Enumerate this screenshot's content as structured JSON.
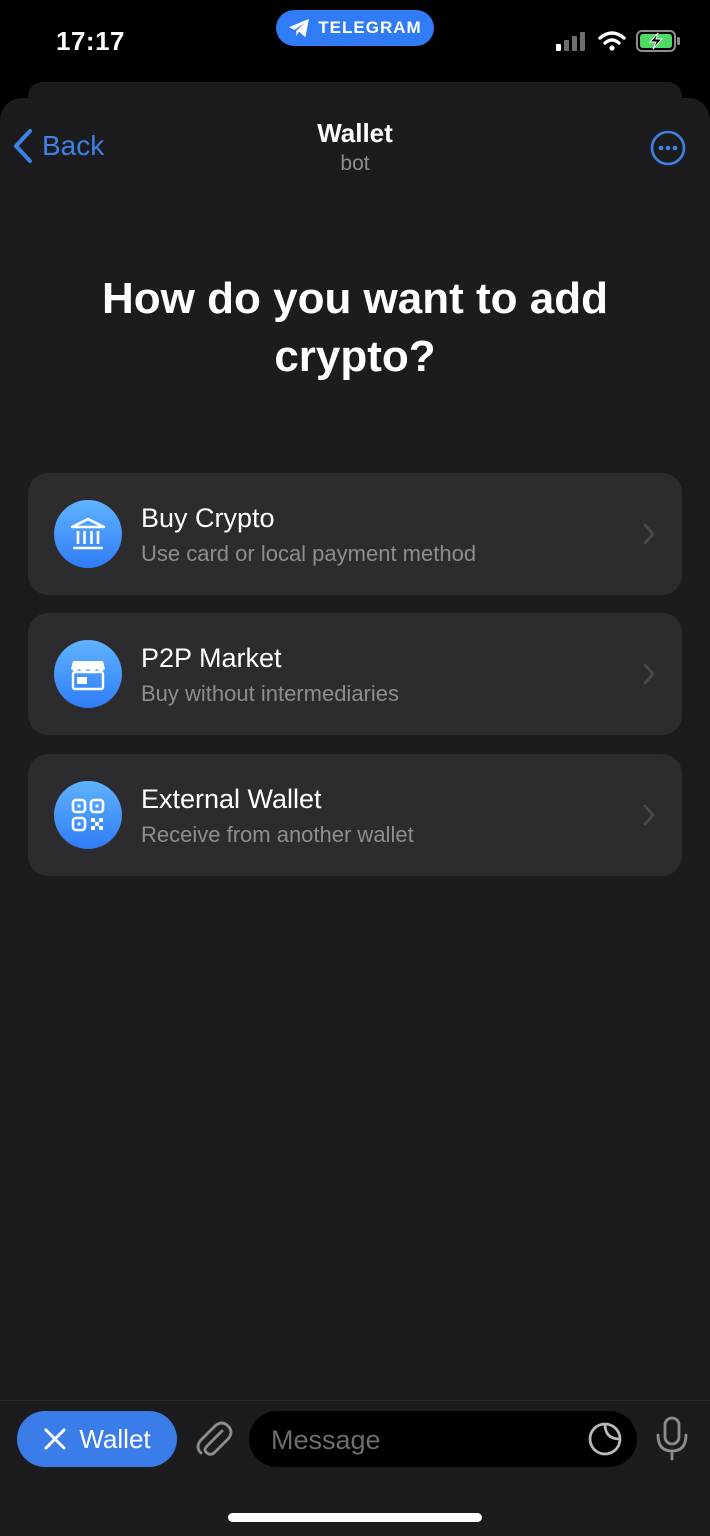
{
  "status_bar": {
    "time": "17:17",
    "app_pill": "TELEGRAM"
  },
  "nav": {
    "back_label": "Back",
    "title": "Wallet",
    "subtitle": "bot"
  },
  "heading": "How do you want to add crypto?",
  "options": [
    {
      "title": "Buy Crypto",
      "subtitle": "Use card or local payment method",
      "icon": "bank-icon"
    },
    {
      "title": "P2P Market",
      "subtitle": "Buy without intermediaries",
      "icon": "store-icon"
    },
    {
      "title": "External Wallet",
      "subtitle": "Receive from another wallet",
      "icon": "qr-code-icon"
    }
  ],
  "composer": {
    "bot_chip_label": "Wallet",
    "message_placeholder": "Message"
  },
  "colors": {
    "accent": "#2f7cf6",
    "link": "#3d82e6",
    "sheet_bg": "#1c1c1e",
    "card_bg": "#2c2c2e",
    "secondary_text": "#8d8d93"
  }
}
